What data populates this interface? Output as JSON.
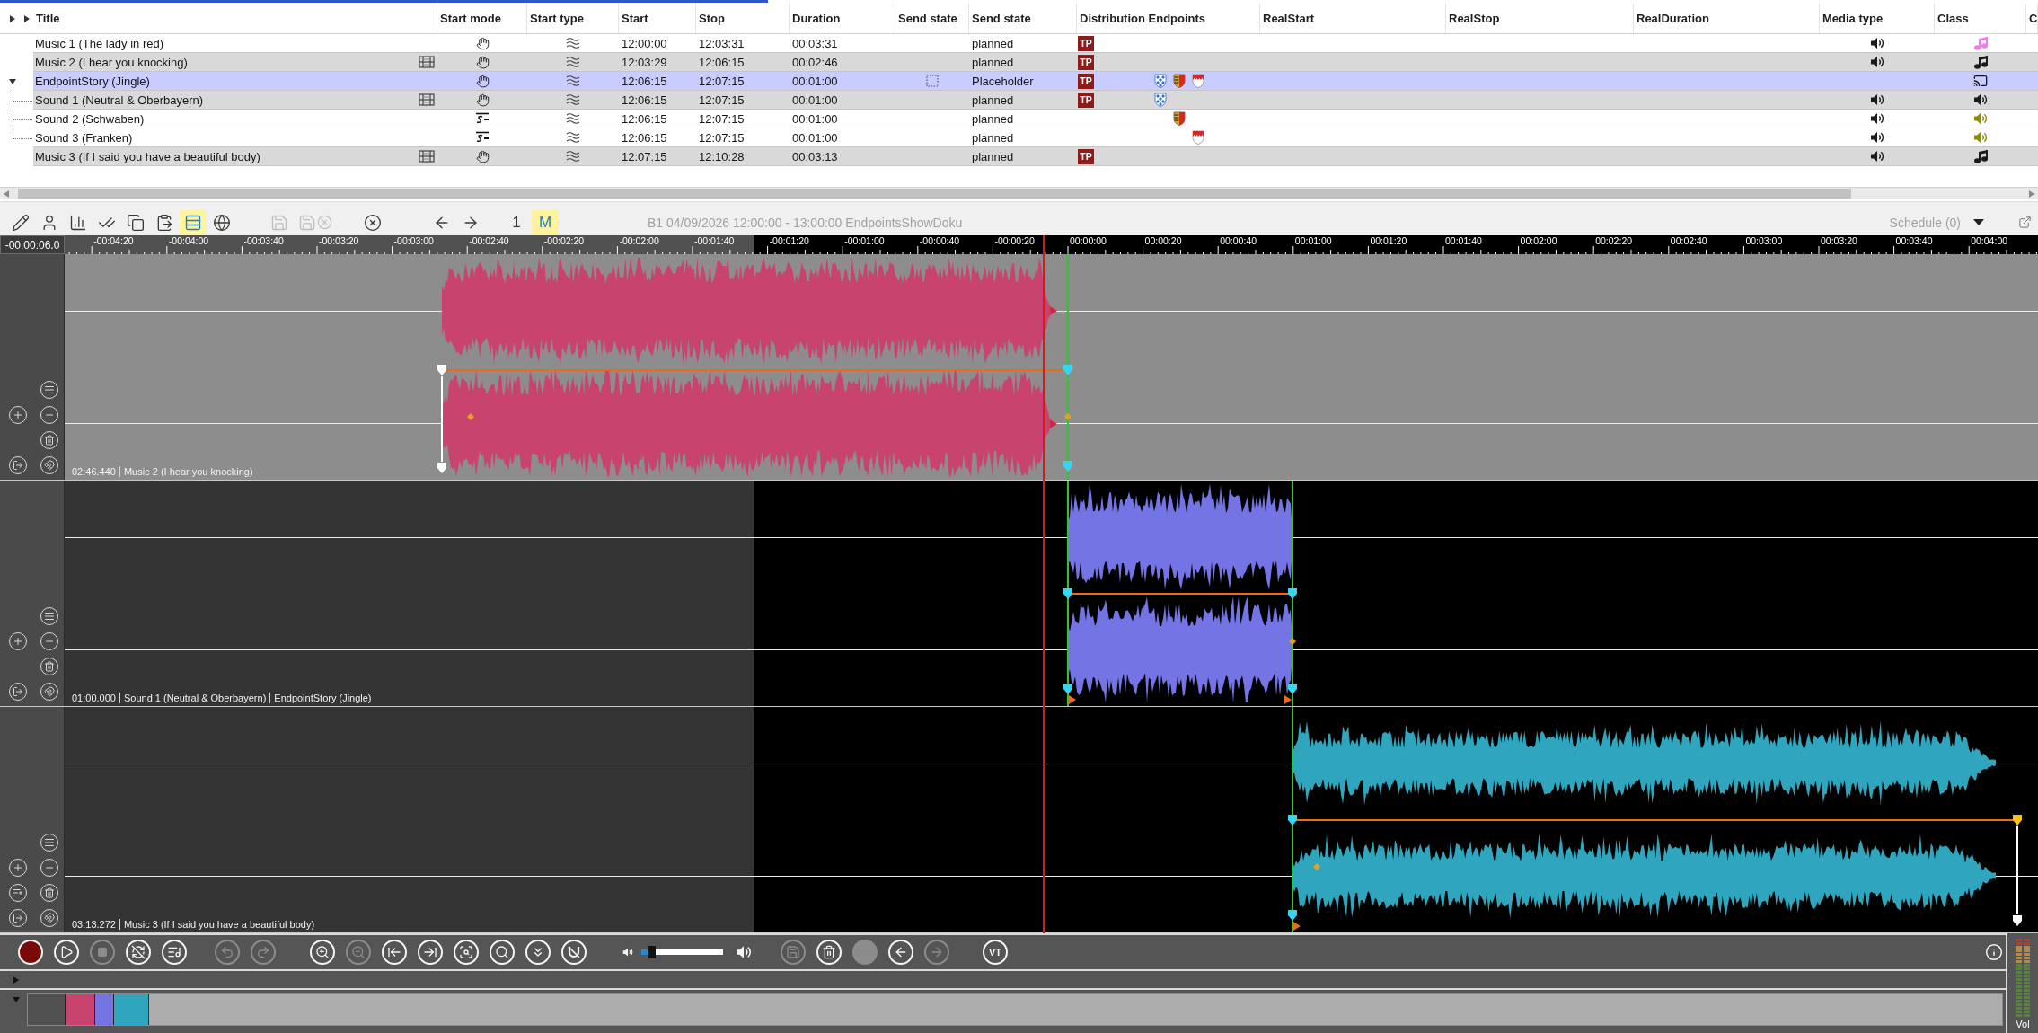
{
  "table": {
    "columns": [
      "Title",
      "Start mode",
      "Start type",
      "Start",
      "Stop",
      "Duration",
      "Send state",
      "Send state",
      "Distribution Endpoints",
      "RealStart",
      "RealStop",
      "RealDuration",
      "Media type",
      "Class",
      "C"
    ],
    "rows": [
      {
        "title": "Music 1 (The lady in red)",
        "selected": false,
        "shaded": false,
        "file": false,
        "start_mode": {
          "kind": "hand"
        },
        "start_type": {
          "kind": "wave"
        },
        "start": "12:00:00",
        "stop": "12:03:31",
        "duration": "00:03:31",
        "send_marker": false,
        "send_state": "planned",
        "distribution": "TP",
        "media": {
          "kind": "audio"
        },
        "class": {
          "kind": "note",
          "color": "#f27ae6"
        }
      },
      {
        "title": "Music 2 (I hear you knocking)",
        "selected": false,
        "shaded": true,
        "file": true,
        "start_mode": {
          "kind": "hand"
        },
        "start_type": {
          "kind": "wave"
        },
        "start": "12:03:29",
        "stop": "12:06:15",
        "duration": "00:02:46",
        "send_marker": false,
        "send_state": "planned",
        "distribution": "TP",
        "media": {
          "kind": "audio"
        },
        "class": {
          "kind": "note",
          "color": "#1a1a1a"
        }
      },
      {
        "title": "EndpointStory (Jingle)",
        "selected": true,
        "shaded": false,
        "file": false,
        "start_mode": {
          "kind": "hand"
        },
        "start_type": {
          "kind": "wave"
        },
        "start": "12:06:15",
        "stop": "12:07:15",
        "duration": "00:01:00",
        "send_marker": true,
        "send_state": "Placeholder",
        "distribution": "TP",
        "endpoints": [
          {
            "kind": "lozenge"
          },
          {
            "kind": "stripes"
          },
          {
            "kind": "rake"
          }
        ],
        "class": {
          "kind": "cast",
          "color": "#1a1a1a"
        },
        "expanded": true,
        "children": [
          {
            "title": "Sound 1 (Neutral & Oberbayern)",
            "selected": false,
            "shaded": true,
            "file": true,
            "start_mode": {
              "kind": "hand"
            },
            "start_type": {
              "kind": "wave"
            },
            "start": "12:06:15",
            "stop": "12:07:15",
            "duration": "00:01:00",
            "send_marker": false,
            "send_state": "planned",
            "distribution": "TP",
            "endpoints": [
              {
                "kind": "lozenge"
              }
            ],
            "media": {
              "kind": "audio"
            },
            "class": {
              "kind": "speaker",
              "color": "#1a1a1a"
            }
          },
          {
            "title": "Sound 2 (Schwaben)",
            "selected": false,
            "shaded": false,
            "file": false,
            "start_mode": {
              "kind": "sequence"
            },
            "start_type": {
              "kind": "wave"
            },
            "start": "12:06:15",
            "stop": "12:07:15",
            "duration": "00:01:00",
            "send_marker": false,
            "send_state": "planned",
            "endpoints": [
              {
                "kind": "stripes"
              }
            ],
            "media": {
              "kind": "audio"
            },
            "class": {
              "kind": "speaker",
              "color": "#8c8c00"
            }
          },
          {
            "title": "Sound 3 (Franken)",
            "selected": false,
            "shaded": false,
            "file": false,
            "start_mode": {
              "kind": "sequence"
            },
            "start_type": {
              "kind": "wave"
            },
            "start": "12:06:15",
            "stop": "12:07:15",
            "duration": "00:01:00",
            "send_marker": false,
            "send_state": "planned",
            "endpoints": [
              {
                "kind": "rake"
              }
            ],
            "media": {
              "kind": "audio"
            },
            "class": {
              "kind": "speaker",
              "color": "#8c8c00"
            }
          }
        ]
      },
      {
        "title": "Music 3 (If I said you have a beautiful body)",
        "selected": false,
        "shaded": true,
        "file": true,
        "start_mode": {
          "kind": "hand"
        },
        "start_type": {
          "kind": "wave"
        },
        "start": "12:07:15",
        "stop": "12:10:28",
        "duration": "00:03:13",
        "send_marker": false,
        "send_state": "planned",
        "distribution": "TP",
        "media": {
          "kind": "audio"
        },
        "class": {
          "kind": "note",
          "color": "#1a1a1a"
        }
      }
    ]
  },
  "toolbar": {
    "groups": [
      [
        {
          "kind": "pencil",
          "selected": false,
          "disabled": false
        },
        {
          "kind": "user",
          "selected": false,
          "disabled": false
        },
        {
          "kind": "chart",
          "selected": false,
          "disabled": false
        },
        {
          "kind": "checks",
          "selected": false,
          "disabled": false
        },
        {
          "kind": "copy",
          "selected": false,
          "disabled": false
        },
        {
          "kind": "paste",
          "selected": false,
          "disabled": false
        },
        {
          "kind": "layout",
          "selected": true,
          "disabled": false
        },
        {
          "kind": "globe",
          "selected": false,
          "disabled": false
        }
      ],
      [
        {
          "kind": "save",
          "selected": false,
          "disabled": true
        },
        {
          "kind": "save-discard",
          "selected": false,
          "disabled": true
        }
      ],
      [
        {
          "kind": "cancel",
          "selected": false,
          "disabled": false
        }
      ],
      [
        {
          "kind": "back",
          "selected": false,
          "disabled": false
        },
        {
          "kind": "forward",
          "selected": false,
          "disabled": false
        }
      ],
      [
        {
          "kind": "text",
          "label": "1",
          "selected": false,
          "disabled": false
        },
        {
          "kind": "text",
          "label": "M",
          "selected": true,
          "disabled": false
        }
      ]
    ],
    "title": "B1 04/09/2026 12:00:00 - 13:00:00 EndpointsShowDoku",
    "schedule": "Schedule (0)"
  },
  "timeline": {
    "position": "-00:00:06.0",
    "labels": [
      "-00:04:20",
      "-00:04:00",
      "-00:03:40",
      "-00:03:20",
      "-00:03:00",
      "-00:02:40",
      "-00:02:20",
      "-00:02:00",
      "-00:01:40",
      "-00:01:20",
      "-00:01:00",
      "-00:00:40",
      "-00:00:20",
      "00:00:00",
      "00:00:20",
      "00:00:40",
      "00:01:00",
      "00:01:20",
      "00:01:40",
      "00:02:00",
      "00:02:20",
      "00:02:40",
      "00:03:00",
      "00:03:20",
      "00:03:40",
      "00:04:00"
    ],
    "tracks": [
      {
        "selected": true,
        "insert": false,
        "color": "#c8446e",
        "caption": [
          "02:46.440",
          "Music 2 (I hear you knocking)"
        ]
      },
      {
        "selected": false,
        "insert": false,
        "color": "#7474e4",
        "caption": [
          "01:00.000",
          "Sound 1 (Neutral & Oberbayern)",
          "EndpointStory (Jingle)"
        ]
      },
      {
        "selected": false,
        "insert": true,
        "color": "#2fa6bd",
        "caption": [
          "03:13.272",
          "Music 3 (If I said you have a beautiful body)"
        ]
      }
    ]
  },
  "transport": {
    "left": [
      [
        {
          "kind": "record",
          "disabled": false
        },
        {
          "kind": "play",
          "disabled": false
        },
        {
          "kind": "stop",
          "disabled": true
        },
        {
          "kind": "loop-off",
          "disabled": false
        },
        {
          "kind": "add-music",
          "disabled": false
        }
      ],
      [
        {
          "kind": "undo",
          "disabled": true
        },
        {
          "kind": "redo",
          "disabled": true
        }
      ],
      [
        {
          "kind": "zoom-in",
          "disabled": false
        },
        {
          "kind": "zoom-out",
          "disabled": true
        },
        {
          "kind": "go-start",
          "disabled": false
        },
        {
          "kind": "go-end",
          "disabled": false
        },
        {
          "kind": "zoom-range",
          "disabled": false
        },
        {
          "kind": "zoom-fit",
          "disabled": false
        },
        {
          "kind": "collapse",
          "disabled": false
        },
        {
          "kind": "snap-off",
          "disabled": false
        }
      ]
    ],
    "volume": {
      "level": 0.13
    },
    "right": [
      [
        {
          "kind": "save",
          "disabled": true
        },
        {
          "kind": "delete-tree",
          "disabled": false
        },
        {
          "kind": "cancel",
          "disabled": true
        },
        {
          "kind": "back",
          "disabled": false
        },
        {
          "kind": "forward",
          "disabled": true
        }
      ],
      [
        {
          "kind": "text",
          "label": "VT",
          "disabled": false
        }
      ]
    ]
  },
  "panels": [
    {
      "expanded": false
    },
    {
      "expanded": true,
      "clips": [
        {
          "color": "#505050"
        },
        {
          "color": "#c8446e"
        },
        {
          "color": "#7474e4"
        },
        {
          "color": "#2fa6bd"
        }
      ]
    }
  ],
  "meter": {
    "label": "Vol"
  }
}
